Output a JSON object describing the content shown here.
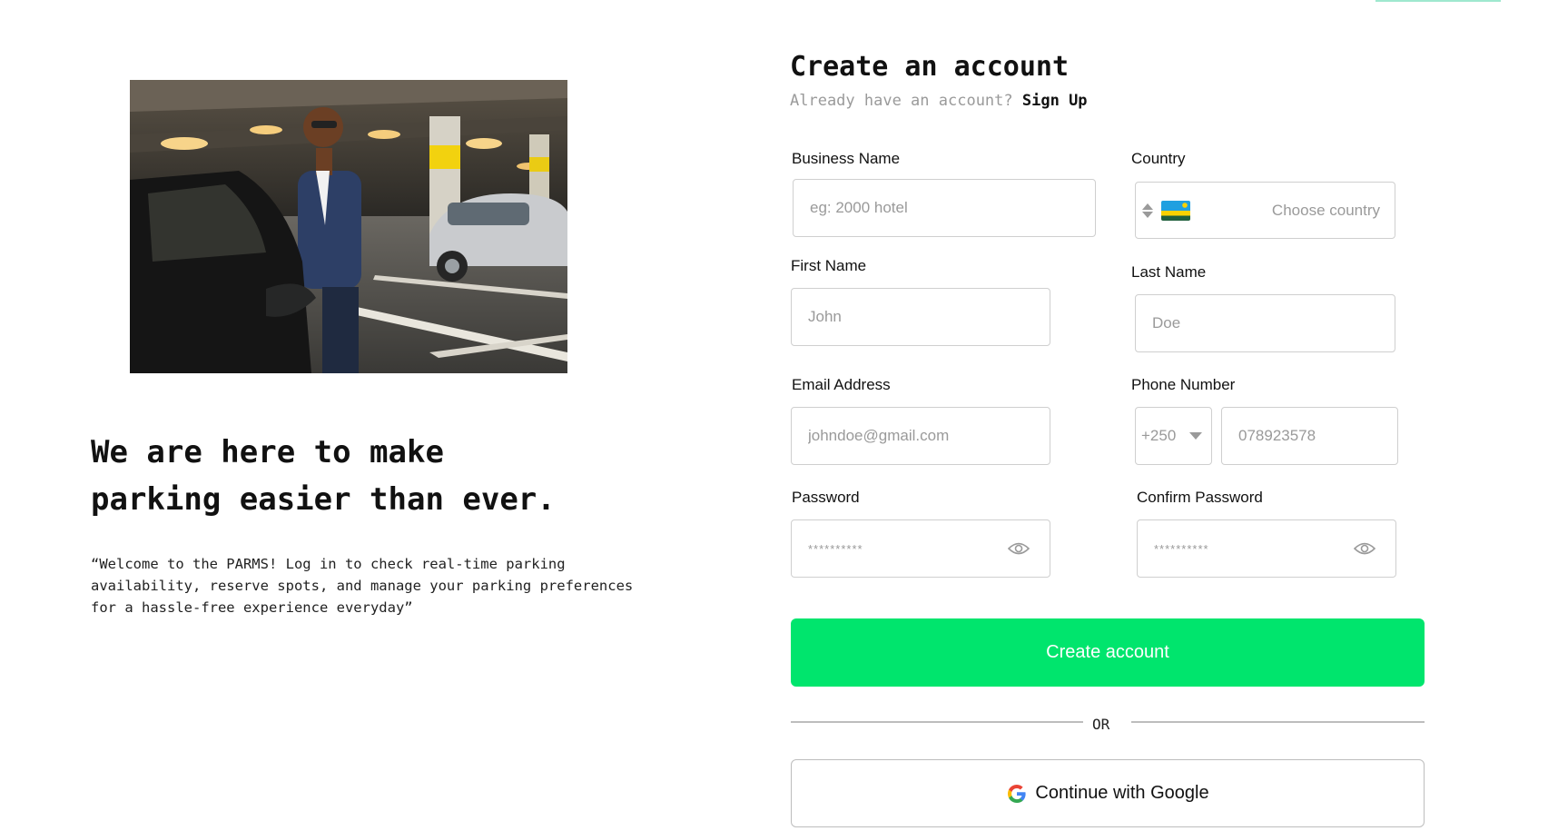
{
  "left": {
    "image_alt": "Man in suit opening a car door in a parking garage",
    "tagline_line1": "We are here to make",
    "tagline_line2": "parking easier than ever.",
    "welcome_line1": "“Welcome to the PARMS! Log in to check real-time parking",
    "welcome_line2": "availability, reserve spots, and manage your parking preferences",
    "welcome_line3": "for a hassle-free experience everyday”"
  },
  "form": {
    "title": "Create an account",
    "already_text": "Already have an account?",
    "signup_link": "Sign Up",
    "business_name": {
      "label": "Business Name",
      "placeholder": "eg: 2000 hotel"
    },
    "country": {
      "label": "Country",
      "placeholder": "Choose country",
      "flag": "rwanda-flag-icon"
    },
    "first_name": {
      "label": "First Name",
      "placeholder": "John"
    },
    "last_name": {
      "label": "Last Name",
      "placeholder": "Doe"
    },
    "email": {
      "label": "Email Address",
      "placeholder": "johndoe@gmail.com"
    },
    "phone": {
      "label": "Phone Number",
      "code": "+250",
      "placeholder": "078923578"
    },
    "password": {
      "label": "Password",
      "placeholder": "**********"
    },
    "confirm_password": {
      "label": "Confirm Password",
      "placeholder": "**********"
    },
    "create_button": "Create account",
    "or_text": "OR",
    "google_button": "Continue with Google"
  },
  "colors": {
    "accent": "#00e56d",
    "border": "#cfcfcf",
    "placeholder": "#9a9a9a"
  }
}
